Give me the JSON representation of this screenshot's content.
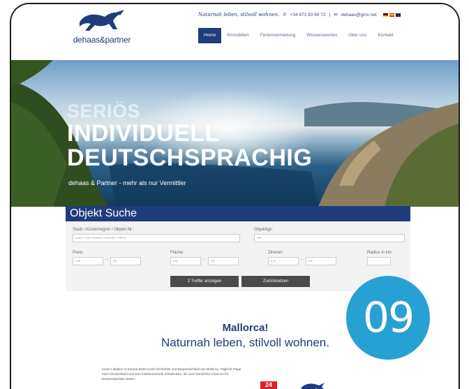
{
  "header": {
    "logo_text": "dehaas&partner",
    "slogan": "Naturnah leben, stilvoll wohnen.",
    "phone": "+34 971 83 69 72",
    "separator": "|",
    "email": "dehaas@gmx.net",
    "nav": [
      "Home",
      "Immobilien",
      "Ferienvermietung",
      "Wissenswertes",
      "Über uns",
      "Kontakt"
    ]
  },
  "hero": {
    "line1": "SERIÖS",
    "line2": "INDIVIDUELL",
    "line3": "DEUTSCHSPRACHIG",
    "subline": "dehaas & Partner - mehr als nur Vermittler"
  },
  "search": {
    "title": "Objekt Suche",
    "location_label": "Stadt / Küstenregion / Objekt-Nr.:",
    "location_placeholder": "ands / Can Picafort / ensulla / Villedi",
    "type_label": "Objekttyp:",
    "type_value": "alle",
    "price_label": "Preis:",
    "area_label": "Fläche:",
    "rooms_label": "Zimmer:",
    "radius_label": "Radius in km:",
    "min_placeholder": "min",
    "max_placeholder": "bis",
    "range_dash": "–",
    "show_button": "2 Treffer anzeigen",
    "reset_button": "Zurücksetzen"
  },
  "content": {
    "title": "Mallorca!",
    "subtitle": "Naturnah leben, stilvoll wohnen.",
    "paragraph": "Keine Lokation in Europa bietet soviel Sicherheit und Bequemlichkeit wie Mallorca. Tägliche Flüge nach Deutschland und eine funktionierende Infrastruktur, die auch berufliche Chancen für Existenzgründer bieten."
  },
  "badge": "09",
  "colors": {
    "brand": "#1f3d7a",
    "badge": "#27a1d4"
  }
}
